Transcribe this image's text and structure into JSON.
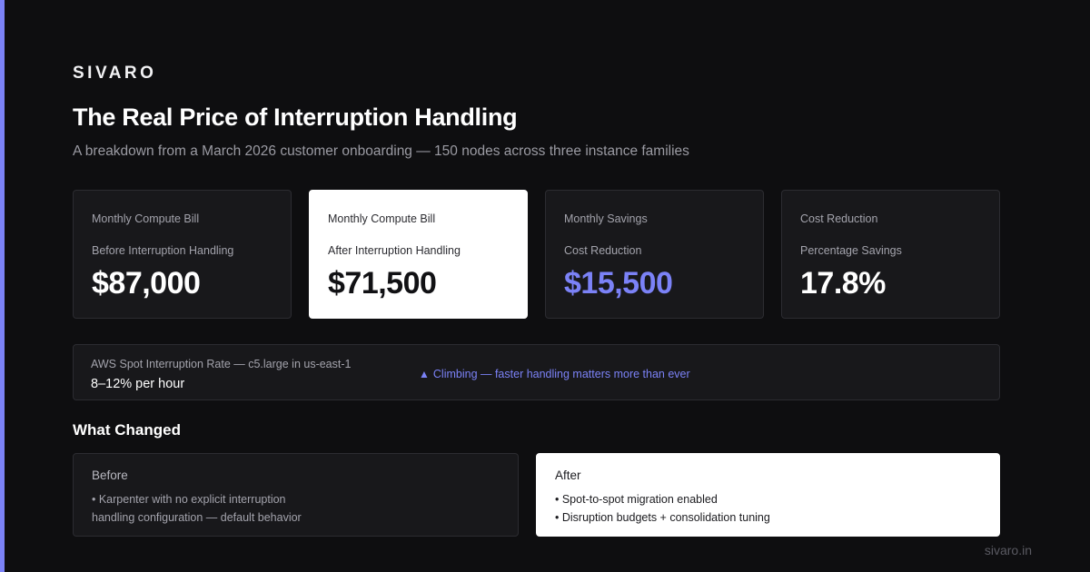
{
  "brand": "SIVARO",
  "title": "The Real Price of Interruption Handling",
  "subtitle": "A breakdown from a March 2026 customer onboarding — 150 nodes across three instance families",
  "metrics": [
    {
      "label": "Monthly Compute Bill",
      "sub": "Before Interruption Handling",
      "value": "$87,000"
    },
    {
      "label": "Monthly Compute Bill",
      "sub": "After Interruption Handling",
      "value": "$71,500"
    },
    {
      "label": "Monthly Savings",
      "sub": "Cost Reduction",
      "value": "$15,500"
    },
    {
      "label": "Cost Reduction",
      "sub": "Percentage Savings",
      "value": "17.8%"
    }
  ],
  "interruption_rate": {
    "label": "AWS Spot Interruption Rate — c5.large in us-east-1",
    "value": "8–12% per hour",
    "trend_icon": "▲",
    "trend_text": "Climbing — faster handling matters more than ever"
  },
  "changes": {
    "heading": "What Changed",
    "before": {
      "title": "Before",
      "items": [
        "• Karpenter with no explicit interruption",
        "handling configuration — default behavior"
      ]
    },
    "after": {
      "title": "After",
      "items": [
        "• Spot-to-spot migration enabled",
        "• Disruption budgets + consolidation tuning"
      ]
    }
  },
  "footer_url": "sivaro.in",
  "colors": {
    "accent": "#7b82f7",
    "background": "#0e0e10",
    "card": "#18181b",
    "highlight_card": "#ffffff"
  }
}
